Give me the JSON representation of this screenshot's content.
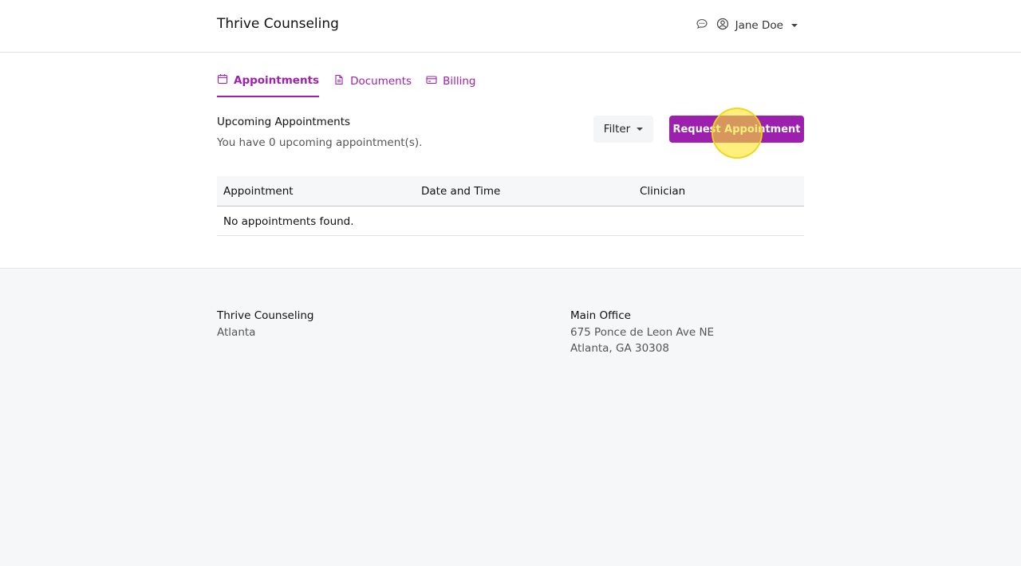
{
  "header": {
    "brand": "Thrive Counseling",
    "user_name": "Jane Doe",
    "icons": [
      "chat-icon",
      "user-circle-icon",
      "caret-down-icon"
    ]
  },
  "tabs": [
    {
      "label": "Appointments",
      "icon": "calendar-icon",
      "active": true
    },
    {
      "label": "Documents",
      "icon": "document-icon",
      "active": false
    },
    {
      "label": "Billing",
      "icon": "credit-card-icon",
      "active": false
    }
  ],
  "appointments": {
    "title": "Upcoming Appointments",
    "subtitle": "You have 0 upcoming appointment(s).",
    "filter_label": "Filter",
    "request_label": "Request Appointment",
    "columns": [
      "Appointment",
      "Date and Time",
      "Clinician"
    ],
    "empty_message": "No appointments found."
  },
  "footer": {
    "left": {
      "name": "Thrive Counseling",
      "city": "Atlanta"
    },
    "right": {
      "title": "Main Office",
      "line1": "675 Ponce de Leon Ave NE",
      "line2": "Atlanta, GA 30308"
    }
  },
  "colors": {
    "accent": "#9c1fae",
    "footer_bg": "#f6f7f9"
  }
}
